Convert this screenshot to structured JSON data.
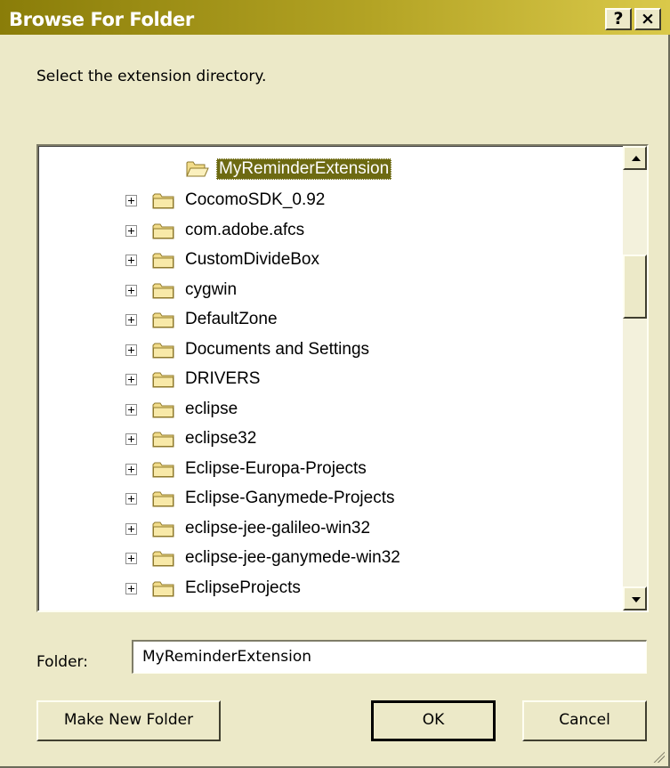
{
  "window": {
    "title": "Browse For Folder",
    "help_button": "?",
    "close_button": "×"
  },
  "prompt": "Select the extension directory.",
  "tree": {
    "selected_item": "MyReminderExtension",
    "items": [
      "CocomoSDK_0.92",
      "com.adobe.afcs",
      "CustomDivideBox",
      "cygwin",
      "DefaultZone",
      "Documents and Settings",
      "DRIVERS",
      "eclipse",
      "eclipse32",
      "Eclipse-Europa-Projects",
      "Eclipse-Ganymede-Projects",
      "eclipse-jee-galileo-win32",
      "eclipse-jee-ganymede-win32",
      "EclipseProjects"
    ]
  },
  "folder_field": {
    "label": "Folder:",
    "value": "MyReminderExtension"
  },
  "buttons": {
    "make_new_folder": "Make New Folder",
    "ok": "OK",
    "cancel": "Cancel"
  },
  "colors": {
    "title_bar_start": "#8a7d09",
    "title_bar_end": "#dac94a",
    "dialog_face": "#ece9c8",
    "selection": "#6d6a12"
  },
  "icons": {
    "folder": "folder-icon",
    "open_folder": "open-folder-icon",
    "expand": "plus-expander-icon"
  }
}
